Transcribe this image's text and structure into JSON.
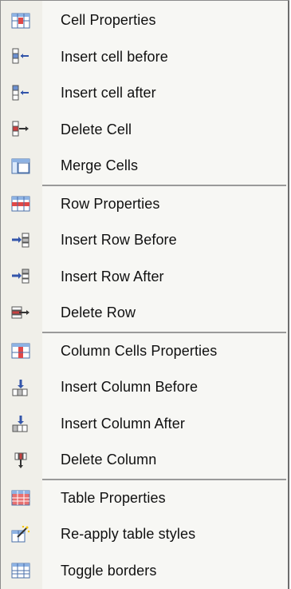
{
  "menu": {
    "groups": [
      {
        "items": [
          {
            "label": "Cell Properties",
            "icon": "cell-properties-icon"
          },
          {
            "label": "Insert cell before",
            "icon": "insert-cell-before-icon"
          },
          {
            "label": "Insert cell after",
            "icon": "insert-cell-after-icon"
          },
          {
            "label": "Delete Cell",
            "icon": "delete-cell-icon"
          },
          {
            "label": "Merge Cells",
            "icon": "merge-cells-icon"
          }
        ]
      },
      {
        "items": [
          {
            "label": "Row Properties",
            "icon": "row-properties-icon"
          },
          {
            "label": "Insert Row Before",
            "icon": "insert-row-before-icon"
          },
          {
            "label": "Insert Row After",
            "icon": "insert-row-after-icon"
          },
          {
            "label": "Delete Row",
            "icon": "delete-row-icon"
          }
        ]
      },
      {
        "items": [
          {
            "label": "Column Cells Properties",
            "icon": "column-properties-icon"
          },
          {
            "label": "Insert Column Before",
            "icon": "insert-column-before-icon"
          },
          {
            "label": "Insert Column After",
            "icon": "insert-column-after-icon"
          },
          {
            "label": "Delete Column",
            "icon": "delete-column-icon"
          }
        ]
      },
      {
        "items": [
          {
            "label": "Table Properties",
            "icon": "table-properties-icon"
          },
          {
            "label": "Re-apply table styles",
            "icon": "reapply-styles-icon"
          },
          {
            "label": "Toggle borders",
            "icon": "toggle-borders-icon"
          }
        ]
      }
    ]
  }
}
